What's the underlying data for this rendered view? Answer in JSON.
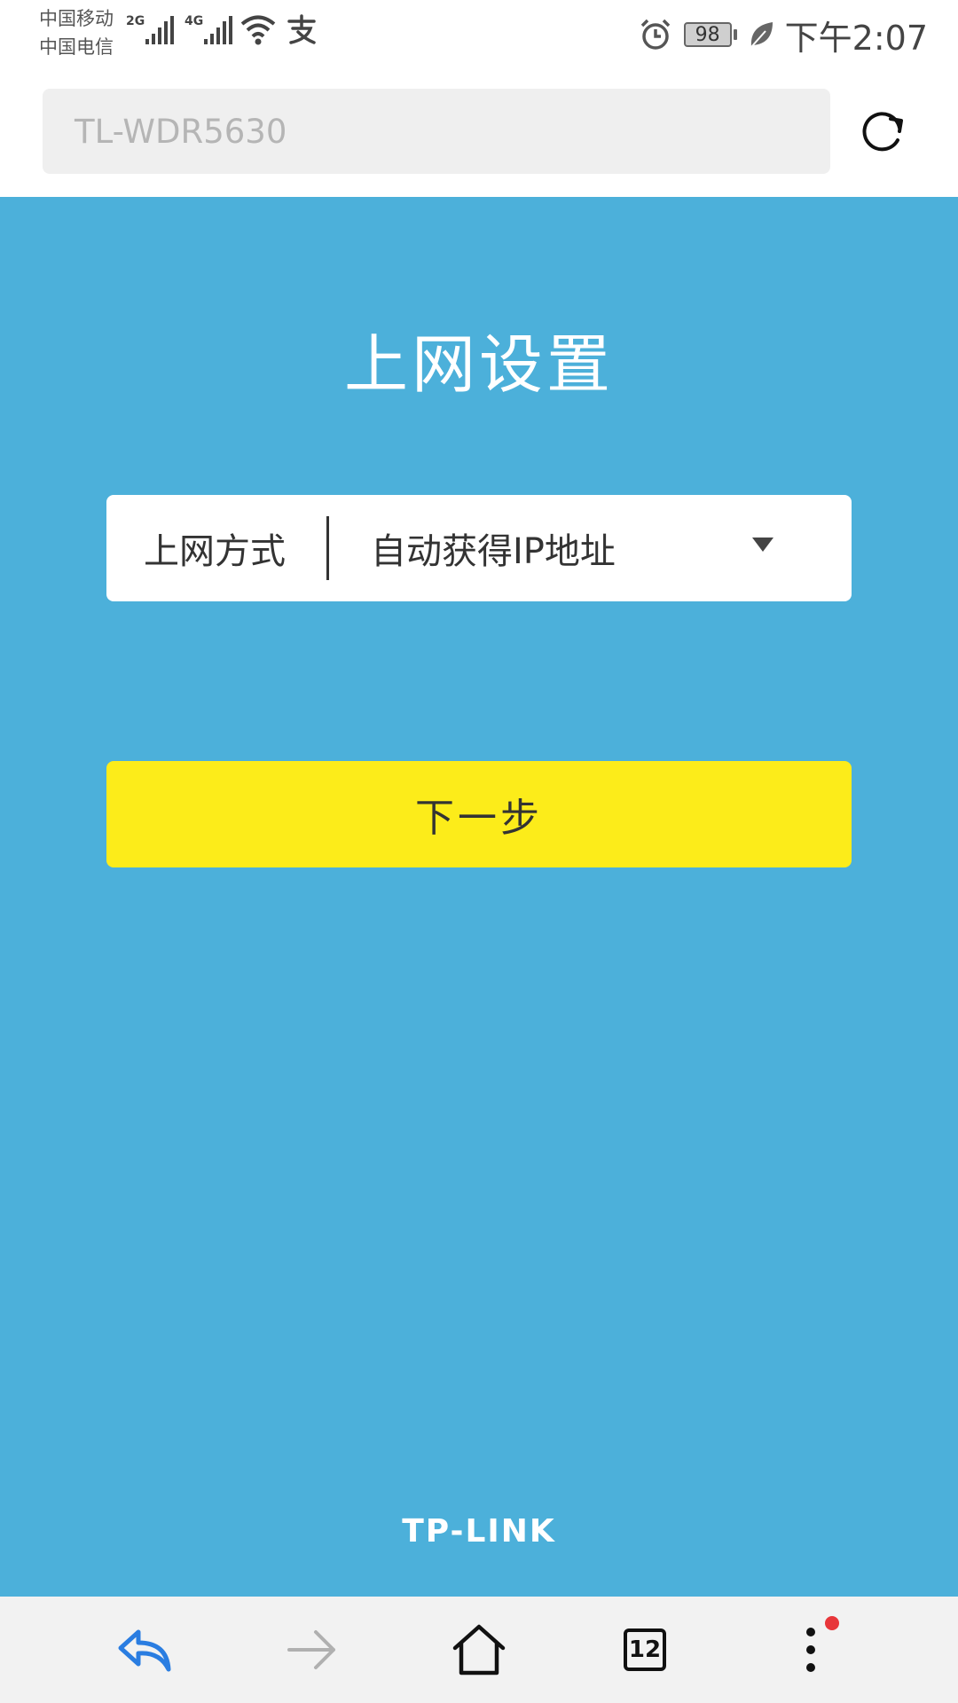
{
  "status_bar": {
    "carrier_1": "中国移动",
    "carrier_2": "中国电信",
    "network_1": "2G",
    "network_2": "4G",
    "battery": "98",
    "time": "下午2:07",
    "icons": [
      "signal-icon",
      "wifi-icon",
      "alipay-icon",
      "alarm-icon",
      "battery-icon",
      "leaf-icon"
    ]
  },
  "address_bar": {
    "url": "TL-WDR5630",
    "reload_icon": "reload-icon"
  },
  "page": {
    "title": "上网设置",
    "connection_type": {
      "label": "上网方式",
      "value": "自动获得IP地址",
      "arrow_icon": "dropdown-arrow-icon"
    },
    "next_button": "下一步",
    "brand": "TP-LINK"
  },
  "bottom_nav": {
    "back_icon": "back-icon",
    "forward_icon": "forward-icon",
    "home_icon": "home-icon",
    "tabs_count": "12",
    "menu_icon": "more-vertical-icon"
  },
  "colors": {
    "page_background": "#4cb0da",
    "button_yellow": "#fcec1a",
    "back_blue": "#2a7de1",
    "notification_red": "#e8363a"
  }
}
